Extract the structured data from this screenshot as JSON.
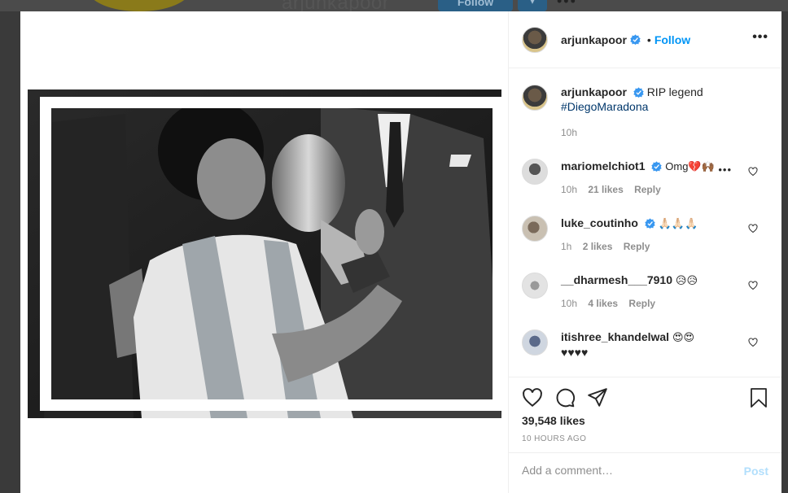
{
  "background": {
    "username": "arjunkapoor",
    "follow_label": "Follow",
    "more_label": "•••"
  },
  "header": {
    "username": "arjunkapoor",
    "dot": "•",
    "follow_label": "Follow",
    "more_label": "•••"
  },
  "caption": {
    "username": "arjunkapoor",
    "text": "RIP legend",
    "hashtag": "#DiegoMaradona",
    "time": "10h"
  },
  "comments": [
    {
      "username": "mariomelchiot1",
      "text": "Omg💔🙌🏾",
      "time": "10h",
      "likes": "21 likes",
      "reply": "Reply",
      "more": "•••"
    },
    {
      "username": "luke_coutinho",
      "text": "🙏🏻🙏🏻🙏🏻",
      "time": "1h",
      "likes": "2 likes",
      "reply": "Reply"
    },
    {
      "username": "__dharmesh___7910",
      "text": "😥😥",
      "time": "10h",
      "likes": "4 likes",
      "reply": "Reply"
    },
    {
      "username": "itishree_khandelwal",
      "text": "😍😍",
      "text2": "♥♥♥♥"
    }
  ],
  "likes": "39,548 likes",
  "time_ago": "10 HOURS AGO",
  "add_comment": {
    "placeholder": "Add a comment…",
    "post_label": "Post"
  },
  "colors": {
    "link": "#0095f6",
    "verified": "#3897f0",
    "muted": "#8e8e8e",
    "hashtag": "#00376b",
    "post_disabled": "#b2dffc"
  },
  "icons": [
    "verified-badge-icon",
    "heart-icon",
    "comment-icon",
    "share-icon",
    "bookmark-icon",
    "more-icon"
  ]
}
